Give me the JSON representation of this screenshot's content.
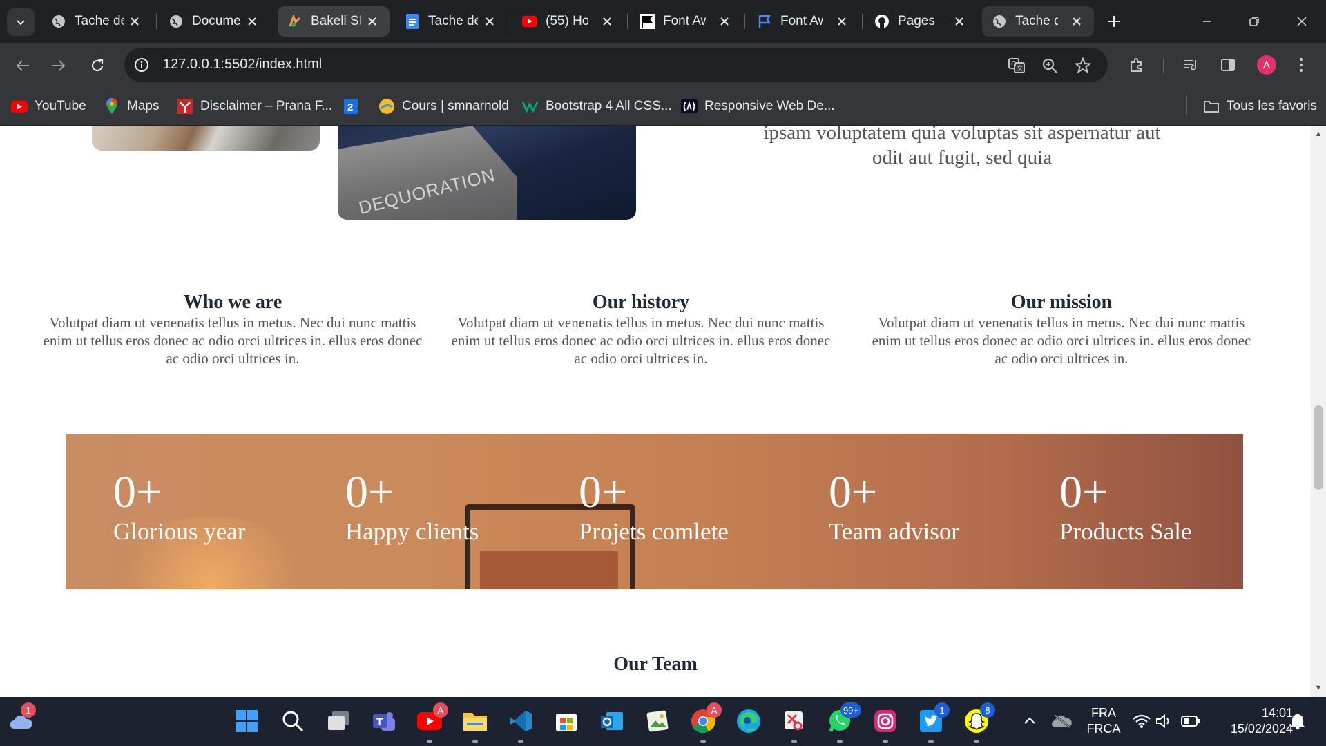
{
  "browser": {
    "tabs": [
      {
        "title": "Tache de",
        "icon": "globe-icon"
      },
      {
        "title": "Docume",
        "icon": "globe-icon"
      },
      {
        "title": "Bakeli SI",
        "icon": "bakeli-icon"
      },
      {
        "title": "Tache de",
        "icon": "docs-icon"
      },
      {
        "title": "(55) Ho",
        "icon": "youtube-icon"
      },
      {
        "title": "Font Aw",
        "icon": "flag-icon"
      },
      {
        "title": "Font Aw",
        "icon": "flag-outline-icon"
      },
      {
        "title": "Pages",
        "icon": "github-icon"
      },
      {
        "title": "Tache de",
        "icon": "globe-icon"
      }
    ],
    "url": "127.0.0.1:5502/index.html",
    "profile_initial": "A",
    "bookmarks": [
      {
        "label": "YouTube",
        "icon": "youtube-icon"
      },
      {
        "label": "Maps",
        "icon": "maps-icon"
      },
      {
        "label": "Disclaimer – Prana F...",
        "icon": "prana-icon"
      },
      {
        "label": "",
        "icon": "number-2-icon",
        "glyph": "2"
      },
      {
        "label": "Cours | smnarnold",
        "icon": "smnarnold-icon"
      },
      {
        "label": "Bootstrap 4 All CSS...",
        "icon": "w3-icon"
      },
      {
        "label": "Responsive Web De...",
        "icon": "freecodecamp-icon"
      }
    ],
    "all_bookmarks_label": "Tous les favoris"
  },
  "page": {
    "hero_text_lines": [
      "ipsam voluptatem quia voluptas sit aspernatur aut",
      "odit aut fugit, sed quia"
    ],
    "image_logo_text": "DEQUORATION",
    "columns": [
      {
        "title": "Who we are",
        "text": "Volutpat diam ut venenatis tellus in metus. Nec dui nunc mattis enim ut tellus eros donec ac odio orci ultrices in. ellus eros donec ac odio orci ultrices in."
      },
      {
        "title": "Our history",
        "text": "Volutpat diam ut venenatis tellus in metus. Nec dui nunc mattis enim ut tellus eros donec ac odio orci ultrices in. ellus eros donec ac odio orci ultrices in."
      },
      {
        "title": "Our mission",
        "text": "Volutpat diam ut venenatis tellus in metus. Nec dui nunc mattis enim ut tellus eros donec ac odio orci ultrices in. ellus eros donec ac odio orci ultrices in."
      }
    ],
    "stats": [
      {
        "number": "0+",
        "label": "Glorious year"
      },
      {
        "number": "0+",
        "label": "Happy clients"
      },
      {
        "number": "0+",
        "label": "Projets comlete"
      },
      {
        "number": "0+",
        "label": "Team advisor"
      },
      {
        "number": "0+",
        "label": "Products Sale"
      }
    ],
    "team_title": "Our Team"
  },
  "taskbar": {
    "weather_badge": "1",
    "apps": [
      {
        "name": "start-icon"
      },
      {
        "name": "search-icon"
      },
      {
        "name": "task-view-icon"
      },
      {
        "name": "teams-icon"
      },
      {
        "name": "youtube-app-icon",
        "badge": "A"
      },
      {
        "name": "file-explorer-icon"
      },
      {
        "name": "vscode-icon"
      },
      {
        "name": "store-icon"
      },
      {
        "name": "outlook-icon"
      },
      {
        "name": "photos-icon"
      },
      {
        "name": "chrome-icon",
        "badge": "A"
      },
      {
        "name": "edge-icon"
      },
      {
        "name": "snipping-tool-icon"
      },
      {
        "name": "whatsapp-icon",
        "badge": "99+"
      },
      {
        "name": "instagram-icon"
      },
      {
        "name": "twitter-icon",
        "badge": "1"
      },
      {
        "name": "snapchat-icon",
        "badge": "8"
      }
    ],
    "language_top": "FRA",
    "language_bottom": "FRCA",
    "time": "14:01",
    "date": "15/02/2024"
  }
}
